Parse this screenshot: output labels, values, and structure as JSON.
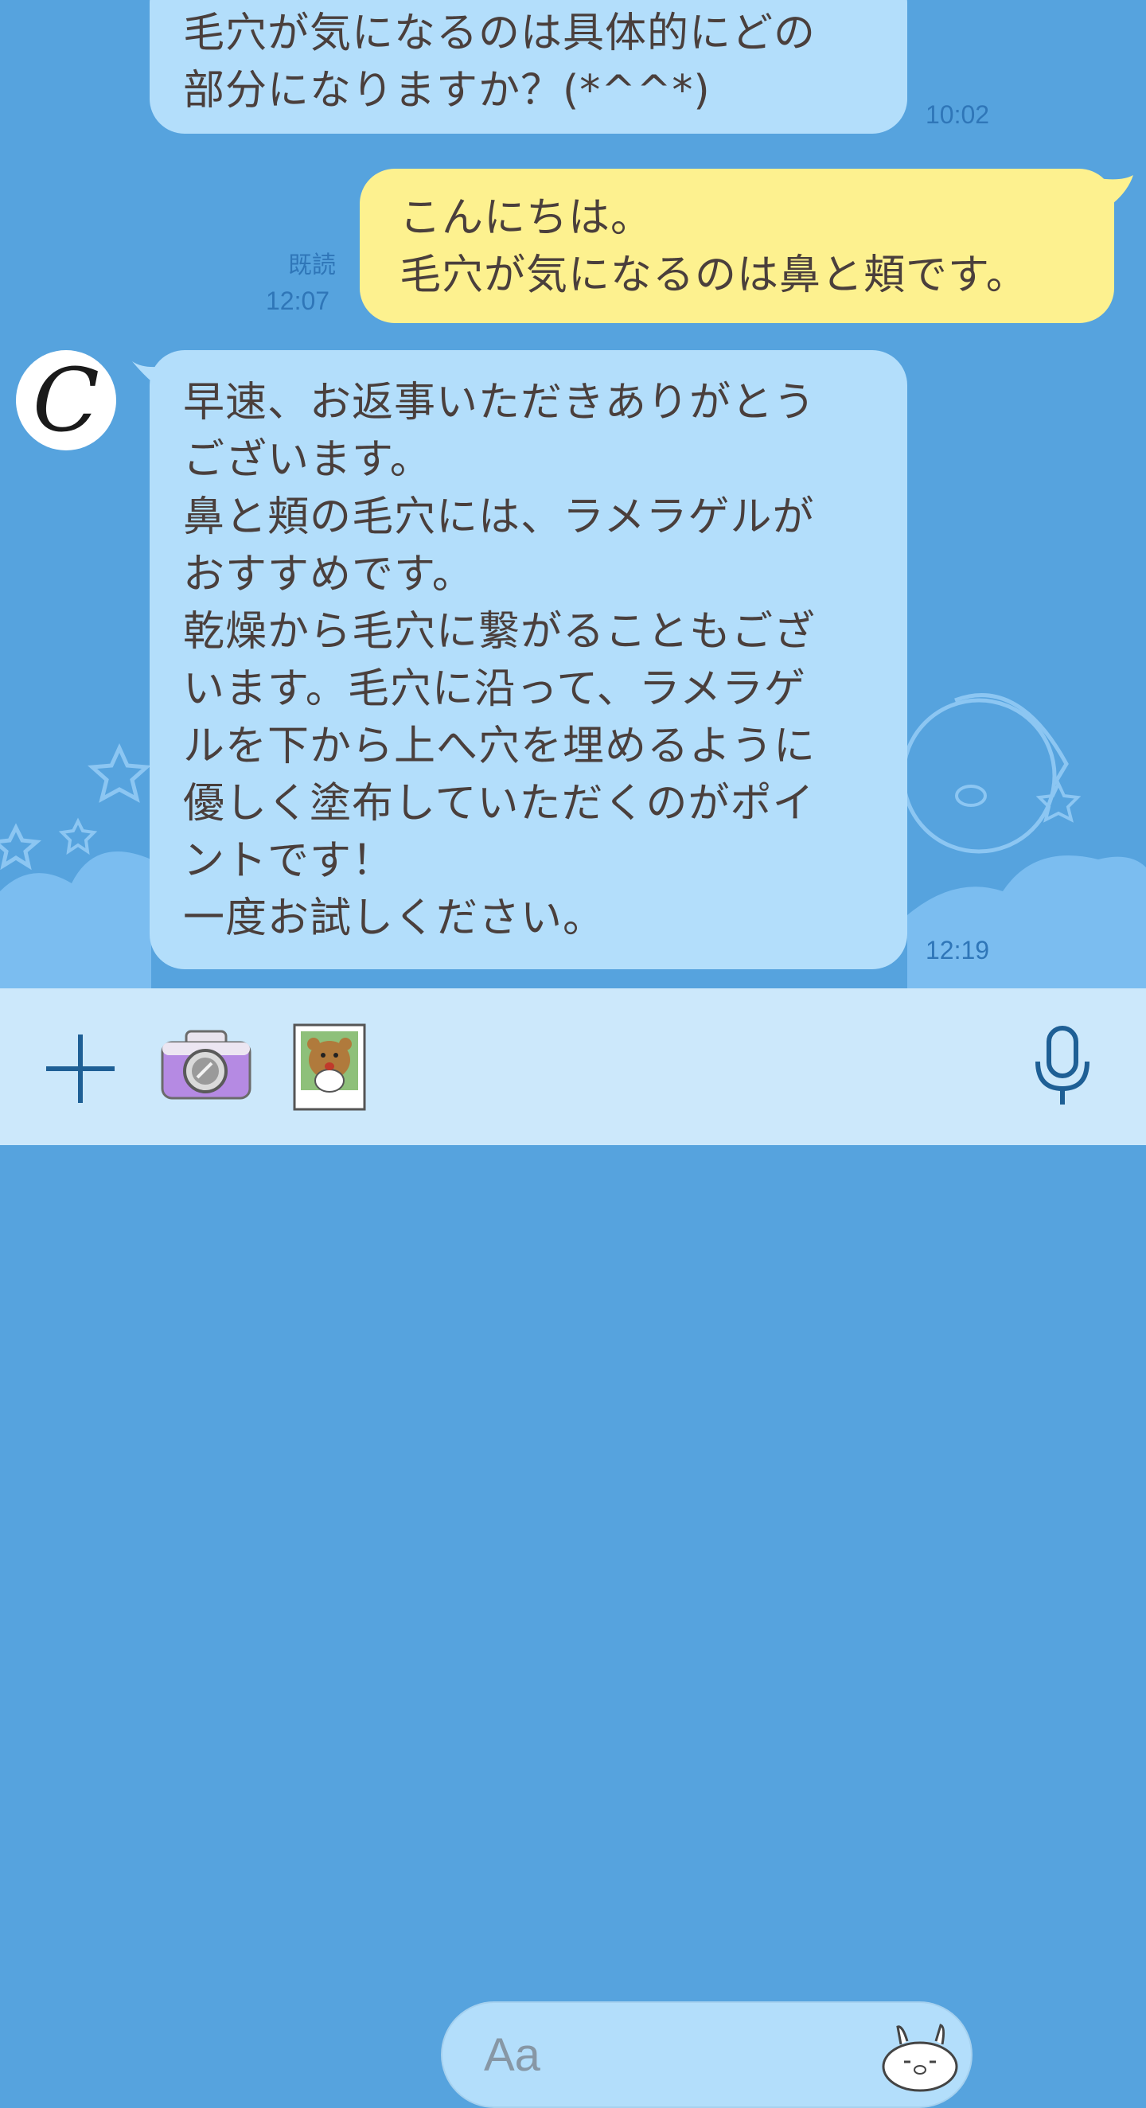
{
  "messages": {
    "m1": {
      "lines": [
        "毛穴が気になるのは具体的にどの",
        "部分になりますか？(*^^*)"
      ],
      "time": "10:02"
    },
    "m2": {
      "lines": [
        "こんにちは。",
        "毛穴が気になるのは鼻と頬です。"
      ],
      "read": "既読",
      "time": "12:07"
    },
    "m3": {
      "lines": [
        "早速、お返事いただきありがとう",
        "ございます。",
        "鼻と頬の毛穴には、ラメラゲルが",
        "おすすめです。",
        "乾燥から毛穴に繋がることもござ",
        "います。毛穴に沿って、ラメラゲ",
        "ルを下から上へ穴を埋めるように",
        "優しく塗布していただくのがポイ",
        "ントです！",
        "一度お試しください。"
      ],
      "time": "12:19"
    }
  },
  "avatar": {
    "letter": "C"
  },
  "input": {
    "placeholder": "Aa",
    "icons": [
      "plus-icon",
      "camera-icon",
      "photo-icon",
      "sticker-icon",
      "microphone-icon"
    ]
  },
  "colors": {
    "background": "#56a3de",
    "incoming_bubble": "#b3defb",
    "outgoing_bubble": "#fdf18f",
    "text": "#4a3f3c",
    "meta": "#2f76b8",
    "input_bar": "#cce8fb",
    "icon": "#1e5f95"
  }
}
